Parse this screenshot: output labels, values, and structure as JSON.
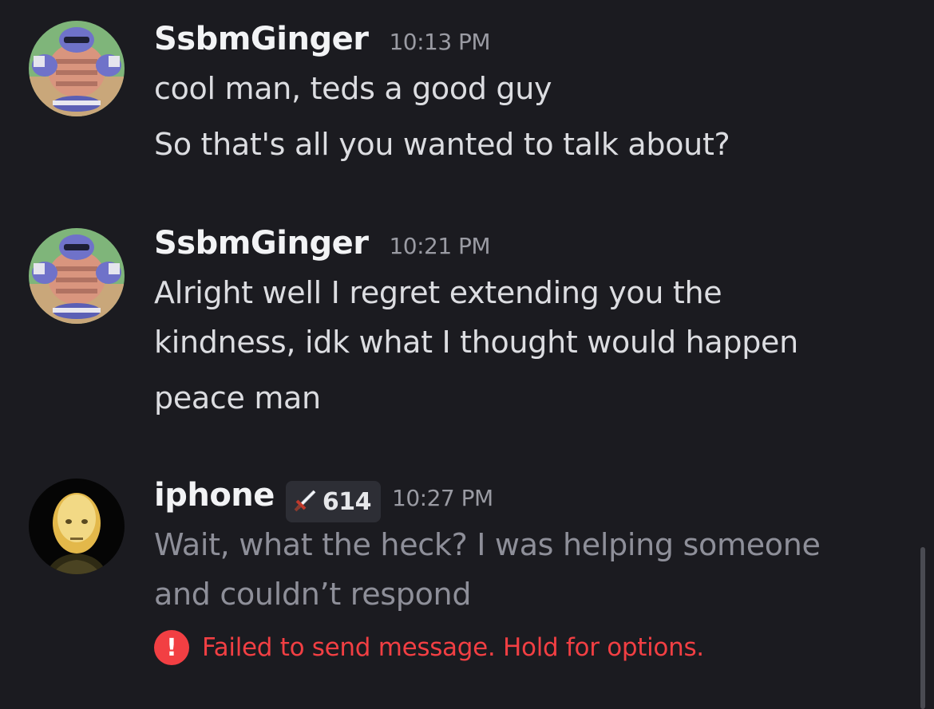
{
  "messages": [
    {
      "username": "SsbmGinger",
      "time": "10:13 PM",
      "lines": [
        "cool man, teds a good guy",
        "So that's all you wanted to talk about?"
      ]
    },
    {
      "username": "SsbmGinger",
      "time": "10:21 PM",
      "lines": [
        "Alright well I regret extending you the",
        "kindness, idk what I thought would happen",
        "peace man"
      ]
    },
    {
      "username": "iphone",
      "tag_icon": "sword-icon",
      "tag_value": "614",
      "time": "10:27 PM",
      "lines": [
        "Wait, what the heck? I was helping someone",
        "and couldn’t respond"
      ],
      "error": "Failed to send message. Hold for options."
    }
  ],
  "colors": {
    "background": "#1b1b20",
    "error": "#f23f43"
  }
}
